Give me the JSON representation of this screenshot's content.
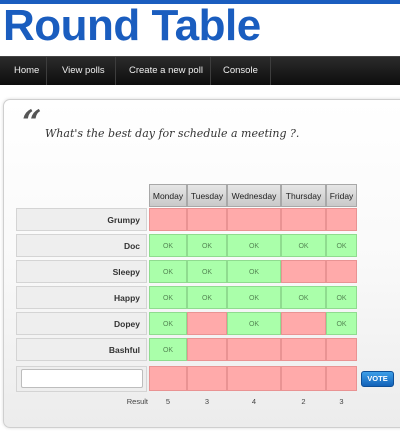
{
  "app": {
    "title": "Round Table"
  },
  "nav": {
    "items": [
      {
        "label": "Home"
      },
      {
        "label": "View polls"
      },
      {
        "label": "Create a new poll"
      },
      {
        "label": "Console"
      }
    ]
  },
  "poll": {
    "question": "What's the best day for schedule a meeting ?.",
    "days": [
      "Monday",
      "Tuesday",
      "Wednesday",
      "Thursday",
      "Friday"
    ],
    "ok_label": "OK",
    "participants": [
      {
        "name": "Grumpy",
        "votes": [
          false,
          false,
          false,
          false,
          false
        ]
      },
      {
        "name": "Doc",
        "votes": [
          true,
          true,
          true,
          true,
          true
        ]
      },
      {
        "name": "Sleepy",
        "votes": [
          true,
          true,
          true,
          false,
          false
        ]
      },
      {
        "name": "Happy",
        "votes": [
          true,
          true,
          true,
          true,
          true
        ]
      },
      {
        "name": "Dopey",
        "votes": [
          true,
          false,
          true,
          false,
          true
        ]
      },
      {
        "name": "Bashful",
        "votes": [
          true,
          false,
          false,
          false,
          false
        ]
      }
    ],
    "new_vote": {
      "name_value": "",
      "name_placeholder": "",
      "votes": [
        false,
        false,
        false,
        false,
        false
      ]
    },
    "vote_label": "VOTE",
    "result_label": "Result",
    "results": [
      "5",
      "3",
      "4",
      "2",
      "3"
    ]
  },
  "colors": {
    "brand": "#1a5dbf",
    "ok": "#aaffaa",
    "no": "#ffaaaa",
    "vote_button": "#1a7ad8"
  }
}
